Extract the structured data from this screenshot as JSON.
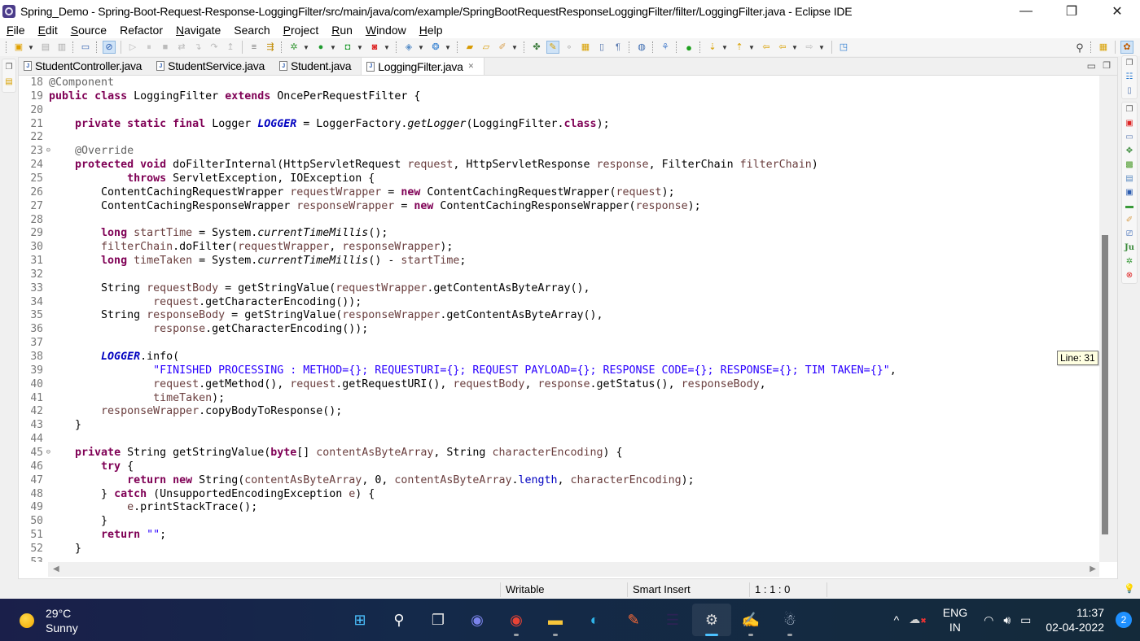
{
  "window": {
    "title": "Spring_Demo - Spring-Boot-Request-Response-LoggingFilter/src/main/java/com/example/SpringBootRequestResponseLoggingFilter/filter/LoggingFilter.java - Eclipse IDE",
    "controls": {
      "minimize": "—",
      "restore": "❐",
      "close": "✕"
    }
  },
  "menu": [
    {
      "label": "File",
      "mnemonic": "F",
      "rest": "ile"
    },
    {
      "label": "Edit",
      "mnemonic": "E",
      "rest": "dit"
    },
    {
      "label": "Source",
      "mnemonic": "S",
      "rest": "ource"
    },
    {
      "label": "Refactor",
      "mnemonic": "",
      "rest": "Refactor"
    },
    {
      "label": "Navigate",
      "mnemonic": "N",
      "rest": "avigate"
    },
    {
      "label": "Search",
      "mnemonic": "",
      "rest": "Search"
    },
    {
      "label": "Project",
      "mnemonic": "P",
      "rest": "roject"
    },
    {
      "label": "Run",
      "mnemonic": "R",
      "rest": "un"
    },
    {
      "label": "Window",
      "mnemonic": "W",
      "rest": "indow"
    },
    {
      "label": "Help",
      "mnemonic": "H",
      "rest": "elp"
    }
  ],
  "toolbar": {
    "icons": [
      "new-icon",
      "save-icon",
      "save-all-icon",
      "terminal-icon",
      "skip-breakpoints-icon",
      "resume-icon",
      "suspend-icon",
      "terminate-icon",
      "disconnect-icon",
      "step-into-icon",
      "step-over-icon",
      "step-return-icon",
      "drop-to-frame-icon",
      "use-step-filters-icon",
      "debug-icon",
      "run-icon",
      "coverage-icon",
      "external-tools-icon",
      "new-java-project-icon",
      "new-class-icon",
      "open-type-icon",
      "open-task-icon",
      "search-icon",
      "toggle-mark-occurrences-icon",
      "toggle-block-selection-icon",
      "show-whitespace-icon",
      "web-browser-icon",
      "spring-icon",
      "green-dot-icon",
      "next-annotation-icon",
      "previous-annotation-icon",
      "back-icon",
      "forward-icon",
      "pin-editor-icon"
    ]
  },
  "tabs": [
    {
      "label": "StudentController.java",
      "active": false
    },
    {
      "label": "StudentService.java",
      "active": false
    },
    {
      "label": "Student.java",
      "active": false
    },
    {
      "label": "LoggingFilter.java",
      "active": true,
      "close": "✕"
    }
  ],
  "editor": {
    "lines": [
      {
        "n": "18",
        "html": "<span class='ann'>@Component</span>"
      },
      {
        "n": "19",
        "html": "<span class='kw'>public</span> <span class='kw'>class</span> LoggingFilter <span class='kw'>extends</span> OncePerRequestFilter {"
      },
      {
        "n": "20",
        "html": ""
      },
      {
        "n": "21",
        "html": "    <span class='kw'>private</span> <span class='kw'>static</span> <span class='kw'>final</span> Logger <span class='fld'>LOGGER</span> = LoggerFactory.<span class='sm'>getLogger</span>(LoggingFilter.<span class='kw'>class</span>);"
      },
      {
        "n": "22",
        "html": ""
      },
      {
        "n": "23",
        "fold": "⊖",
        "html": "    <span class='ann'>@Override</span>"
      },
      {
        "n": "24",
        "mark": "△",
        "html": "    <span class='kw'>protected</span> <span class='kw'>void</span> doFilterInternal(HttpServletRequest <span class='var'>request</span>, HttpServletResponse <span class='var'>response</span>, FilterChain <span class='var'>filterChain</span>)"
      },
      {
        "n": "25",
        "html": "            <span class='kw'>throws</span> ServletException, IOException {"
      },
      {
        "n": "26",
        "html": "        ContentCachingRequestWrapper <span class='var'>requestWrapper</span> = <span class='kw'>new</span> ContentCachingRequestWrapper(<span class='var'>request</span>);"
      },
      {
        "n": "27",
        "html": "        ContentCachingResponseWrapper <span class='var'>responseWrapper</span> = <span class='kw'>new</span> ContentCachingResponseWrapper(<span class='var'>response</span>);"
      },
      {
        "n": "28",
        "html": ""
      },
      {
        "n": "29",
        "html": "        <span class='kw'>long</span> <span class='var'>startTime</span> = System.<span class='sm'>currentTimeMillis</span>();"
      },
      {
        "n": "30",
        "html": "        <span class='var'>filterChain</span>.doFilter(<span class='var'>requestWrapper</span>, <span class='var'>responseWrapper</span>);"
      },
      {
        "n": "31",
        "html": "        <span class='kw'>long</span> <span class='var'>timeTaken</span> = System.<span class='sm'>currentTimeMillis</span>() - <span class='var'>startTime</span>;"
      },
      {
        "n": "32",
        "html": ""
      },
      {
        "n": "33",
        "html": "        String <span class='var'>requestBody</span> = getStringValue(<span class='var'>requestWrapper</span>.getContentAsByteArray(),"
      },
      {
        "n": "34",
        "html": "                <span class='var'>request</span>.getCharacterEncoding());"
      },
      {
        "n": "35",
        "html": "        String <span class='var'>responseBody</span> = getStringValue(<span class='var'>responseWrapper</span>.getContentAsByteArray(),"
      },
      {
        "n": "36",
        "html": "                <span class='var'>response</span>.getCharacterEncoding());"
      },
      {
        "n": "37",
        "html": ""
      },
      {
        "n": "38",
        "html": "        <span class='fld'>LOGGER</span>.info("
      },
      {
        "n": "39",
        "html": "                <span class='str'>\"FINISHED PROCESSING : METHOD={}; REQUESTURI={}; REQUEST PAYLOAD={}; RESPONSE CODE={}; RESPONSE={}; TIM TAKEN={}\"</span>,"
      },
      {
        "n": "40",
        "html": "                <span class='var'>request</span>.getMethod(), <span class='var'>request</span>.getRequestURI(), <span class='var'>requestBody</span>, <span class='var'>response</span>.getStatus(), <span class='var'>responseBody</span>,"
      },
      {
        "n": "41",
        "html": "                <span class='var'>timeTaken</span>);"
      },
      {
        "n": "42",
        "html": "        <span class='var'>responseWrapper</span>.copyBodyToResponse();"
      },
      {
        "n": "43",
        "html": "    }"
      },
      {
        "n": "44",
        "html": ""
      },
      {
        "n": "45",
        "fold": "⊖",
        "html": "    <span class='kw'>private</span> String getStringValue(<span class='kw'>byte</span>[] <span class='var'>contentAsByteArray</span>, String <span class='var'>characterEncoding</span>) {"
      },
      {
        "n": "46",
        "html": "        <span class='kw'>try</span> {"
      },
      {
        "n": "47",
        "html": "            <span class='kw'>return</span> <span class='kw'>new</span> String(<span class='var'>contentAsByteArray</span>, 0, <span class='var'>contentAsByteArray</span>.<span class='mfld'>length</span>, <span class='var'>characterEncoding</span>);"
      },
      {
        "n": "48",
        "html": "        } <span class='kw'>catch</span> (UnsupportedEncodingException <span class='var'>e</span>) {"
      },
      {
        "n": "49",
        "html": "            <span class='var'>e</span>.printStackTrace();"
      },
      {
        "n": "50",
        "html": "        }"
      },
      {
        "n": "51",
        "html": "        <span class='kw'>return</span> <span class='str'>\"\"</span>;"
      },
      {
        "n": "52",
        "html": "    }"
      },
      {
        "n": "53",
        "html": ""
      }
    ],
    "tooltip": "Line: 31"
  },
  "status": {
    "writable": "Writable",
    "insert_mode": "Smart Insert",
    "position": "1 : 1 : 0"
  },
  "taskbar": {
    "weather": {
      "temp": "29°C",
      "condition": "Sunny"
    },
    "apps": [
      {
        "name": "windows-start-icon",
        "glyph": "⊞",
        "color": "#4cc2ff",
        "running": false,
        "active": false
      },
      {
        "name": "search-icon",
        "glyph": "⚲",
        "color": "#ffffff",
        "running": false,
        "active": false
      },
      {
        "name": "task-view-icon",
        "glyph": "❐",
        "color": "#e0e0e0",
        "running": false,
        "active": false
      },
      {
        "name": "teams-chat-icon",
        "glyph": "◉",
        "color": "#7b83eb",
        "running": false,
        "active": false
      },
      {
        "name": "chrome-icon",
        "glyph": "◉",
        "color": "#ea4335",
        "running": true,
        "active": false
      },
      {
        "name": "file-explorer-icon",
        "glyph": "▬",
        "color": "#f8c63a",
        "running": true,
        "active": false
      },
      {
        "name": "edge-icon",
        "glyph": "◐",
        "color": "#2fb3e8",
        "running": false,
        "active": false
      },
      {
        "name": "postman-icon",
        "glyph": "✎",
        "color": "#ff6c37",
        "running": false,
        "active": false
      },
      {
        "name": "eclipse-icon",
        "glyph": "☰",
        "color": "#2c2255",
        "running": false,
        "active": false
      },
      {
        "name": "geany-ide-icon",
        "glyph": "⚙",
        "color": "#dddddd",
        "running": true,
        "active": true
      },
      {
        "name": "notepad-plus-plus-icon",
        "glyph": "✍",
        "color": "#8bc34a",
        "running": true,
        "active": false
      },
      {
        "name": "git-gui-icon",
        "glyph": "☃",
        "color": "#c9d6e8",
        "running": true,
        "active": false
      }
    ],
    "tray": {
      "chevron": "^",
      "language": "ENG",
      "region": "IN",
      "time": "11:37",
      "date": "02-04-2022",
      "notifications": "2"
    }
  }
}
